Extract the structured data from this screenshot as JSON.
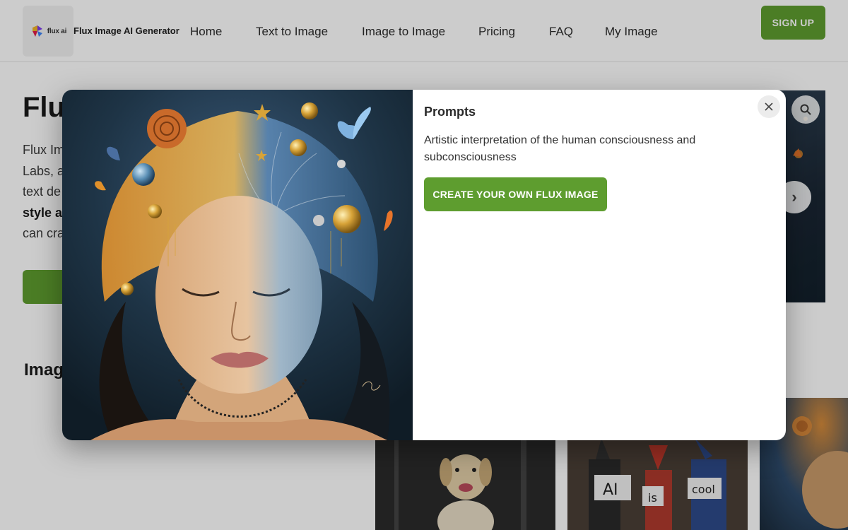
{
  "header": {
    "logo_text": "flux ai",
    "brand_name": "Flux Image AI Generator",
    "nav": [
      {
        "label": "Home"
      },
      {
        "label": "Text to Image"
      },
      {
        "label": "Image to Image"
      },
      {
        "label": "Pricing"
      },
      {
        "label": "FAQ"
      },
      {
        "label": "My Image"
      }
    ],
    "signup_label": "SIGN UP"
  },
  "background": {
    "hero_title": "Flux",
    "hero_desc_lines": [
      "Flux Im",
      "Labs, a",
      "text de",
      "style a",
      "can cra"
    ],
    "section_title": "Imag",
    "next_arrow": "›",
    "thumb_sign_words": [
      "AI",
      "is",
      "cool"
    ]
  },
  "modal": {
    "prompts_title": "Prompts",
    "prompt_text": "Artistic interpretation of the human consciousness and subconsciousness",
    "create_label": "CREATE YOUR OWN FLUX IMAGE",
    "image_alt_icon": "surreal-face-artwork"
  },
  "colors": {
    "accent": "#5e9d2f",
    "overlay": "rgba(0,0,0,0.20)"
  },
  "icons": {
    "close": "close-icon",
    "zoom": "zoom-icon",
    "next": "chevron-right-icon"
  }
}
